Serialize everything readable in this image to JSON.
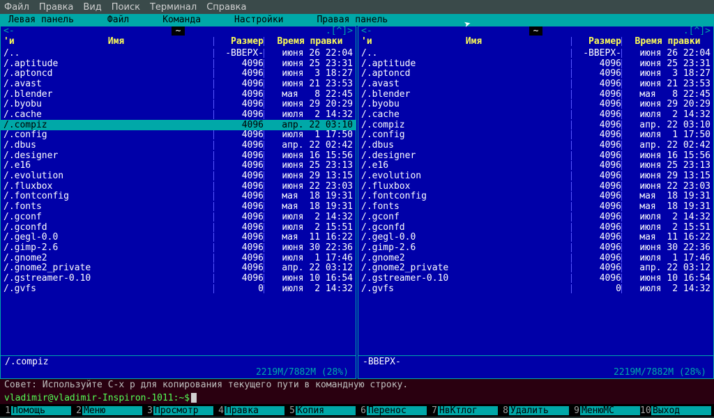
{
  "titlebar": [
    "Файл",
    "Правка",
    "Вид",
    "Поиск",
    "Терминал",
    "Справка"
  ],
  "mc_menu": [
    "Левая панель",
    "Файл",
    "Команда",
    "Настройки",
    "Правая панель"
  ],
  "hdr": {
    "mark": "'и",
    "name": "Имя",
    "size": "Размер",
    "time": "Время правки"
  },
  "panel_left": {
    "path": "~",
    "rows": [
      {
        "n": "/..",
        "s": "-ВВЕРХ-",
        "t": "июня 26 22:04"
      },
      {
        "n": "/.aptitude",
        "s": "4096",
        "t": "июня 25 23:31"
      },
      {
        "n": "/.aptoncd",
        "s": "4096",
        "t": "июня  3 18:27"
      },
      {
        "n": "/.avast",
        "s": "4096",
        "t": "июня 21 23:53"
      },
      {
        "n": "/.blender",
        "s": "4096",
        "t": "мая   8 22:45"
      },
      {
        "n": "/.byobu",
        "s": "4096",
        "t": "июня 29 20:29"
      },
      {
        "n": "/.cache",
        "s": "4096",
        "t": "июля  2 14:32"
      },
      {
        "n": "/.compiz",
        "s": "4096",
        "t": "апр. 22 03:10",
        "sel": true
      },
      {
        "n": "/.config",
        "s": "4096",
        "t": "июля  1 17:50"
      },
      {
        "n": "/.dbus",
        "s": "4096",
        "t": "апр. 22 02:42"
      },
      {
        "n": "/.designer",
        "s": "4096",
        "t": "июня 16 15:56"
      },
      {
        "n": "/.e16",
        "s": "4096",
        "t": "июня 25 23:13"
      },
      {
        "n": "/.evolution",
        "s": "4096",
        "t": "июня 29 13:15"
      },
      {
        "n": "/.fluxbox",
        "s": "4096",
        "t": "июня 22 23:03"
      },
      {
        "n": "/.fontconfig",
        "s": "4096",
        "t": "мая  18 19:31"
      },
      {
        "n": "/.fonts",
        "s": "4096",
        "t": "мая  18 19:31"
      },
      {
        "n": "/.gconf",
        "s": "4096",
        "t": "июля  2 14:32"
      },
      {
        "n": "/.gconfd",
        "s": "4096",
        "t": "июля  2 15:51"
      },
      {
        "n": "/.gegl-0.0",
        "s": "4096",
        "t": "мая  11 16:22"
      },
      {
        "n": "/.gimp-2.6",
        "s": "4096",
        "t": "июня 30 22:36"
      },
      {
        "n": "/.gnome2",
        "s": "4096",
        "t": "июля  1 17:46"
      },
      {
        "n": "/.gnome2_private",
        "s": "4096",
        "t": "апр. 22 03:12"
      },
      {
        "n": "/.gstreamer-0.10",
        "s": "4096",
        "t": "июня 10 16:54"
      },
      {
        "n": "/.gvfs",
        "s": "0",
        "t": "июля  2 14:32"
      }
    ],
    "mini": "/.compiz",
    "status": "2219M/7882M (28%)"
  },
  "panel_right": {
    "path": "~",
    "rows": [
      {
        "n": "/..",
        "s": "-ВВЕРХ-",
        "t": "июня 26 22:04"
      },
      {
        "n": "/.aptitude",
        "s": "4096",
        "t": "июня 25 23:31"
      },
      {
        "n": "/.aptoncd",
        "s": "4096",
        "t": "июня  3 18:27"
      },
      {
        "n": "/.avast",
        "s": "4096",
        "t": "июня 21 23:53"
      },
      {
        "n": "/.blender",
        "s": "4096",
        "t": "мая   8 22:45"
      },
      {
        "n": "/.byobu",
        "s": "4096",
        "t": "июня 29 20:29"
      },
      {
        "n": "/.cache",
        "s": "4096",
        "t": "июля  2 14:32"
      },
      {
        "n": "/.compiz",
        "s": "4096",
        "t": "апр. 22 03:10"
      },
      {
        "n": "/.config",
        "s": "4096",
        "t": "июля  1 17:50"
      },
      {
        "n": "/.dbus",
        "s": "4096",
        "t": "апр. 22 02:42"
      },
      {
        "n": "/.designer",
        "s": "4096",
        "t": "июня 16 15:56"
      },
      {
        "n": "/.e16",
        "s": "4096",
        "t": "июня 25 23:13"
      },
      {
        "n": "/.evolution",
        "s": "4096",
        "t": "июня 29 13:15"
      },
      {
        "n": "/.fluxbox",
        "s": "4096",
        "t": "июня 22 23:03"
      },
      {
        "n": "/.fontconfig",
        "s": "4096",
        "t": "мая  18 19:31"
      },
      {
        "n": "/.fonts",
        "s": "4096",
        "t": "мая  18 19:31"
      },
      {
        "n": "/.gconf",
        "s": "4096",
        "t": "июля  2 14:32"
      },
      {
        "n": "/.gconfd",
        "s": "4096",
        "t": "июля  2 15:51"
      },
      {
        "n": "/.gegl-0.0",
        "s": "4096",
        "t": "мая  11 16:22"
      },
      {
        "n": "/.gimp-2.6",
        "s": "4096",
        "t": "июня 30 22:36"
      },
      {
        "n": "/.gnome2",
        "s": "4096",
        "t": "июля  1 17:46"
      },
      {
        "n": "/.gnome2_private",
        "s": "4096",
        "t": "апр. 22 03:12"
      },
      {
        "n": "/.gstreamer-0.10",
        "s": "4096",
        "t": "июня 10 16:54"
      },
      {
        "n": "/.gvfs",
        "s": "0",
        "t": "июля  2 14:32"
      }
    ],
    "mini": "-ВВЕРХ-",
    "status": "2219M/7882M (28%)"
  },
  "hint": "Совет: Используйте C-x p для копирования текущего пути в командную строку.",
  "prompt": "vladimir@vladimir-Inspiron-1011:~$ ",
  "fkeys": [
    {
      "n": "1",
      "l": "Помощь"
    },
    {
      "n": "2",
      "l": "Меню"
    },
    {
      "n": "3",
      "l": "Просмотр"
    },
    {
      "n": "4",
      "l": "Правка"
    },
    {
      "n": "5",
      "l": "Копия"
    },
    {
      "n": "6",
      "l": "Перенос"
    },
    {
      "n": "7",
      "l": "НвКтлог"
    },
    {
      "n": "8",
      "l": "Удалить"
    },
    {
      "n": "9",
      "l": "МенюMC"
    },
    {
      "n": "10",
      "l": "Выход"
    }
  ]
}
